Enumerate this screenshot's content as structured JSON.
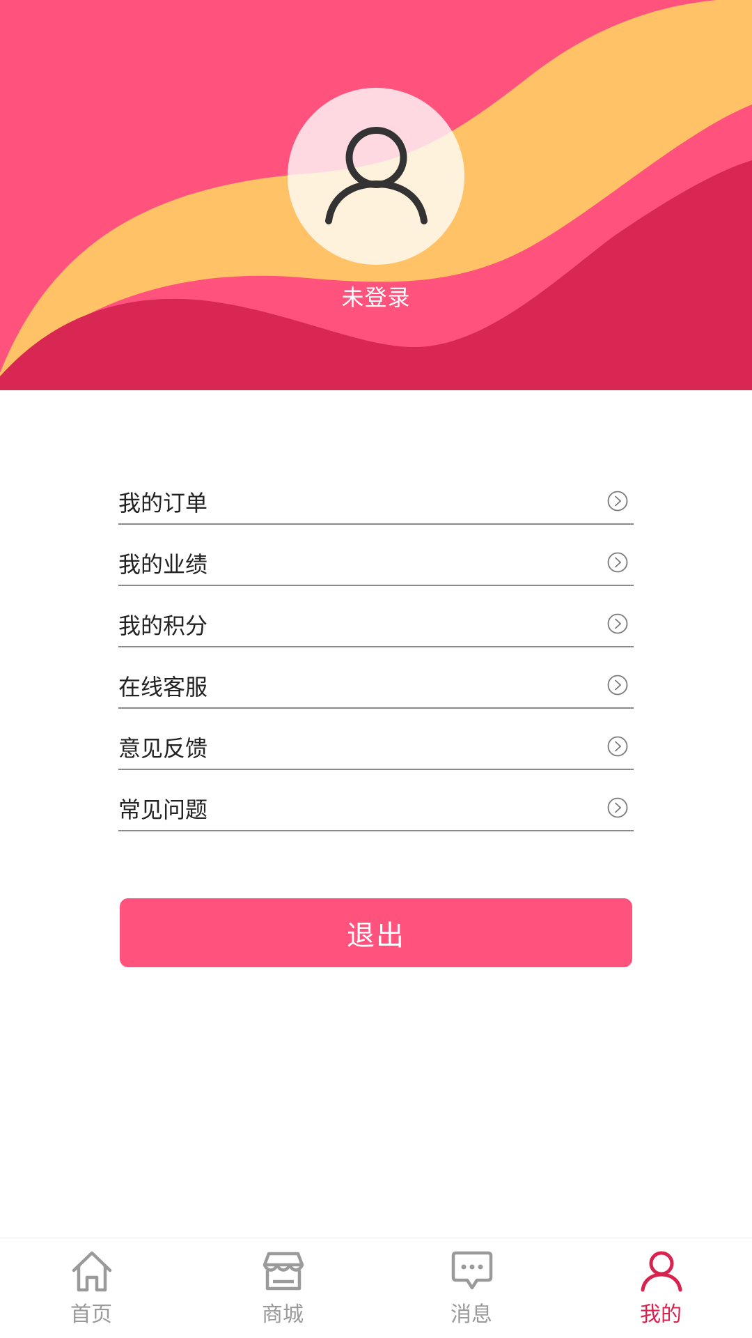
{
  "header": {
    "login_status": "未登录",
    "colors": {
      "primary": "#ff527c",
      "wave_yellow": "#ffc266",
      "wave_dark": "#d92753"
    },
    "avatar_icon": "user-icon"
  },
  "menu": {
    "items": [
      {
        "label": "我的订单",
        "icon": "chevron-right-circle-icon"
      },
      {
        "label": "我的业绩",
        "icon": "chevron-right-circle-icon"
      },
      {
        "label": "我的积分",
        "icon": "chevron-right-circle-icon"
      },
      {
        "label": "在线客服",
        "icon": "chevron-right-circle-icon"
      },
      {
        "label": "意见反馈",
        "icon": "chevron-right-circle-icon"
      },
      {
        "label": "常见问题",
        "icon": "chevron-right-circle-icon"
      }
    ]
  },
  "logout": {
    "label": "退出"
  },
  "tabbar": {
    "active_color": "#d9234f",
    "inactive_color": "#9a9a9a",
    "tabs": [
      {
        "label": "首页",
        "icon": "home-icon",
        "active": false
      },
      {
        "label": "商城",
        "icon": "store-icon",
        "active": false
      },
      {
        "label": "消息",
        "icon": "message-icon",
        "active": false
      },
      {
        "label": "我的",
        "icon": "user-icon",
        "active": true
      }
    ]
  }
}
